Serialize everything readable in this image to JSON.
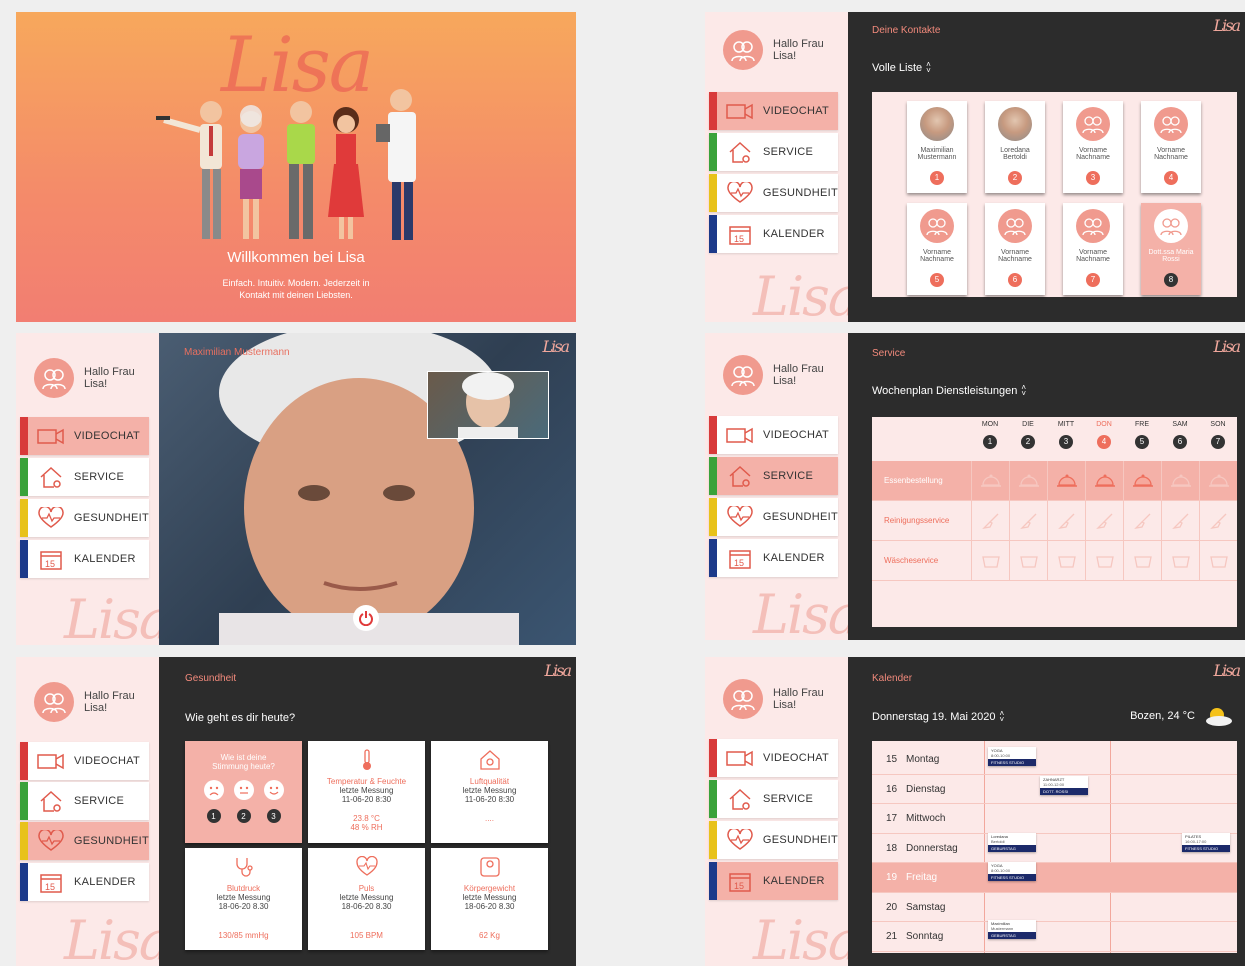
{
  "common": {
    "greeting": "Hallo Frau Lisa!",
    "logo": "Lisa",
    "nav": [
      {
        "label": "VIDEOCHAT",
        "icon": "video-icon",
        "color": "#d83a3a"
      },
      {
        "label": "SERVICE",
        "icon": "house-gear-icon",
        "color": "#3aa23a"
      },
      {
        "label": "GESUNDHEIT",
        "icon": "heart-pulse-icon",
        "color": "#e8c21a"
      },
      {
        "label": "KALENDER",
        "icon": "calendar-icon",
        "color": "#1c3a8a"
      }
    ],
    "accent": "#f28a7c"
  },
  "welcome": {
    "logo": "Lisa",
    "title": "Willkommen bei Lisa",
    "subtitle_line1": "Einfach. Intuitiv. Modern. Jederzeit in",
    "subtitle_line2": "Kontakt mit deinen Liebsten."
  },
  "videochat": {
    "caller": "Maximilian Mustermann",
    "logo": "Lisa",
    "end_call_icon": "power-icon"
  },
  "contacts": {
    "title": "Deine Kontakte",
    "subtitle": "Volle Liste",
    "items": [
      {
        "name1": "Maximilian",
        "name2": "Mustermann",
        "n": "1",
        "photo": true
      },
      {
        "name1": "Loredana",
        "name2": "Bertoldi",
        "n": "2",
        "photo": true
      },
      {
        "name1": "Vorname",
        "name2": "Nachname",
        "n": "3",
        "photo": false
      },
      {
        "name1": "Vorname",
        "name2": "Nachname",
        "n": "4",
        "photo": false
      },
      {
        "name1": "Vorname",
        "name2": "Nachname",
        "n": "5",
        "photo": false
      },
      {
        "name1": "Vorname",
        "name2": "Nachname",
        "n": "6",
        "photo": false
      },
      {
        "name1": "Vorname",
        "name2": "Nachname",
        "n": "7",
        "photo": false
      },
      {
        "name1": "Dott.ssa Maria",
        "name2": "Rossi",
        "n": "8",
        "photo": false
      }
    ]
  },
  "service": {
    "title": "Service",
    "subtitle": "Wochenplan Dienstleistungen",
    "days": [
      {
        "label": "MON",
        "n": "1"
      },
      {
        "label": "DIE",
        "n": "2"
      },
      {
        "label": "MITT",
        "n": "3"
      },
      {
        "label": "DON",
        "n": "4"
      },
      {
        "label": "FRE",
        "n": "5"
      },
      {
        "label": "SAM",
        "n": "6"
      },
      {
        "label": "SON",
        "n": "7"
      }
    ],
    "rows": [
      {
        "label": "Essenbestellung",
        "icon": "food-cloche-icon",
        "active": [
          false,
          false,
          true,
          true,
          true,
          false,
          false
        ]
      },
      {
        "label": "Reinigungsservice",
        "icon": "broom-icon",
        "active": [
          false,
          false,
          false,
          false,
          false,
          false,
          false
        ]
      },
      {
        "label": "Wäscheservice",
        "icon": "basket-icon",
        "active": [
          false,
          false,
          false,
          false,
          false,
          false,
          false
        ]
      }
    ]
  },
  "health": {
    "title": "Gesundheit",
    "subtitle": "Wie geht es dir heute?",
    "mood": {
      "line1": "Wie ist deine",
      "line2": "Stimmung heute?",
      "n": [
        "1",
        "2",
        "3"
      ]
    },
    "cards": [
      {
        "icon": "thermometer-icon",
        "title": "Temperatur & Feuchte",
        "sub1": "letzte Messung",
        "sub2": "11-06-20 8:30",
        "v1": "23.8 °C",
        "v2": "48 % RH"
      },
      {
        "icon": "house-air-icon",
        "title": "Luftqualität",
        "sub1": "letzte Messung",
        "sub2": "11-06-20 8:30",
        "v1": "....",
        "v2": ""
      },
      {
        "icon": "stethoscope-icon",
        "title": "Blutdruck",
        "sub1": "letzte Messung",
        "sub2": "18-06-20 8.30",
        "v1": "130/85 mmHg",
        "v2": ""
      },
      {
        "icon": "heart-pulse-icon",
        "title": "Puls",
        "sub1": "letzte Messung",
        "sub2": "18-06-20 8.30",
        "v1": "105 BPM",
        "v2": ""
      },
      {
        "icon": "scale-icon",
        "title": "Körpergewicht",
        "sub1": "letzte Messung",
        "sub2": "18-06-20 8.30",
        "v1": "62 Kg",
        "v2": ""
      }
    ]
  },
  "calendar": {
    "title": "Kalender",
    "date": "Donnerstag 19. Mai 2020",
    "weather": "Bozen, 24 °C",
    "weather_icon": "sun-cloud-icon",
    "days": [
      {
        "num": "15",
        "name": "Montag"
      },
      {
        "num": "16",
        "name": "Dienstag"
      },
      {
        "num": "17",
        "name": "Mittwoch"
      },
      {
        "num": "18",
        "name": "Donnerstag"
      },
      {
        "num": "19",
        "name": "Freitag"
      },
      {
        "num": "20",
        "name": "Samstag"
      },
      {
        "num": "21",
        "name": "Sonntag"
      }
    ],
    "events": [
      {
        "top": "YOGA",
        "sub": "8:00-10:00",
        "tag": "FITNESS STUDIO"
      },
      {
        "top": "ZAHNARZT",
        "sub": "11:00-12:00",
        "tag": "DOTT. ROSSI"
      },
      {
        "top": "Loredana",
        "sub": "Bertoldi",
        "tag": "GEBURSTAG"
      },
      {
        "top": "PILATES",
        "sub": "16:00-17:00",
        "tag": "FITNESS STUDIO"
      },
      {
        "top": "YOGA",
        "sub": "8:00-10:00",
        "tag": "FITNESS STUDIO"
      },
      {
        "top": "Maximilian",
        "sub": "Mustermann",
        "tag": "GEBURSTAG"
      }
    ]
  }
}
